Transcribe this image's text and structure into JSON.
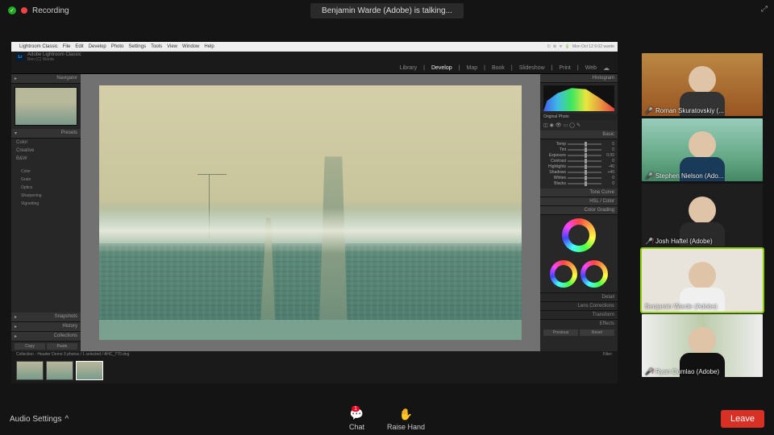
{
  "zoom": {
    "recording": "Recording",
    "talking": "Benjamin Warde (Adobe) is talking...",
    "audio_settings": "Audio Settings",
    "chat": "Chat",
    "chat_badge": "1",
    "raise_hand": "Raise Hand",
    "leave": "Leave"
  },
  "mac_menu": [
    "Lightroom Classic",
    "File",
    "Edit",
    "Develop",
    "Photo",
    "Settings",
    "Tools",
    "View",
    "Window",
    "Help"
  ],
  "mac_right": "Mon Oct 12  6:02  warde",
  "lr": {
    "title_brand": "Adobe Lightroom Classic",
    "title_user": "Ben (C) Warde",
    "modules": [
      "Library",
      "Develop",
      "Map",
      "Book",
      "Slideshow",
      "Print",
      "Web"
    ],
    "active_module": "Develop",
    "left": {
      "navigator": "Navigator",
      "presets": "Presets",
      "preset_items": [
        "Color",
        "Creative",
        "B&W"
      ],
      "preset_items2": [
        "Color",
        "Grain",
        "Optics",
        "Sharpening",
        "Vignetting"
      ],
      "snapshots": "Snapshots",
      "history": "History",
      "collections": "Collections"
    },
    "right": {
      "histogram": "Histogram",
      "original": "Original Photo",
      "basic": "Basic",
      "sliders": [
        {
          "label": "Temp",
          "val": "0"
        },
        {
          "label": "Tint",
          "val": "0"
        },
        {
          "label": "Exposure",
          "val": "0.00"
        },
        {
          "label": "Contrast",
          "val": "0"
        },
        {
          "label": "Highlights",
          "val": "-40"
        },
        {
          "label": "Shadows",
          "val": "+40"
        },
        {
          "label": "Whites",
          "val": "0"
        },
        {
          "label": "Blacks",
          "val": "0"
        }
      ],
      "tone_curve": "Tone Curve",
      "hsl": "HSL / Color",
      "color_grading": "Color Grading",
      "detail": "Detail",
      "lens": "Lens Corrections",
      "transform": "Transform",
      "effects": "Effects"
    },
    "filmstrip_info": "Collection - Header Demo    3 photos / 1 selected / AHC_770.dng",
    "prev": "Previous",
    "reset": "Reset",
    "copy": "Copy",
    "paste": "Paste"
  },
  "participants": [
    {
      "name": "Roman Skuratovskiy (...",
      "muted": true,
      "shirt": "#333",
      "bg": "linear-gradient(#b84,#952)"
    },
    {
      "name": "Stephen Nielson (Ado...",
      "muted": true,
      "shirt": "#1a3a5a",
      "bg": "linear-gradient(#9cb,#6a8 60%,#486)"
    },
    {
      "name": "Josh Haftel (Adobe)",
      "muted": true,
      "shirt": "#2a2a2a",
      "bg": "#1e1e1e"
    },
    {
      "name": "Benjamin Warde (Adobe)",
      "muted": false,
      "speaking": true,
      "shirt": "#f0f0f0",
      "bg": "#e8e4dc"
    },
    {
      "name": "Ryan Dumlao (Adobe)",
      "muted": true,
      "shirt": "#111",
      "bg": "linear-gradient(90deg,#eee,#bca 50%,#eee)"
    }
  ]
}
